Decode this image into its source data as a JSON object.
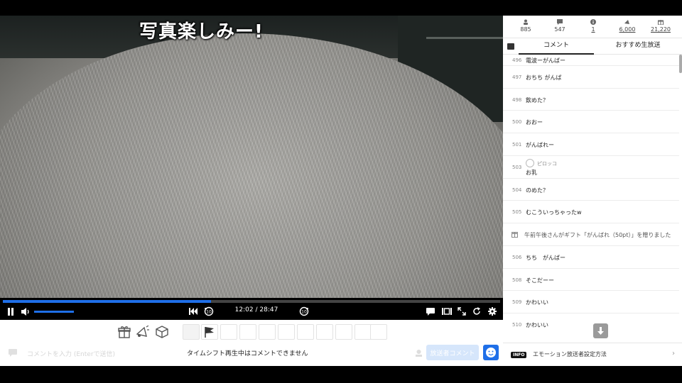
{
  "video": {
    "overlay_text": "写真楽しみー!"
  },
  "player": {
    "time_display": "12:02 / 28:47",
    "progress_fraction": 0.418,
    "volume_fraction": 0.9,
    "icons": {
      "pause": "pause-icon",
      "volume": "volume-icon",
      "skip_back": "skip-to-start-icon",
      "rewind": "rewind-10-icon",
      "forward": "forward-10-icon",
      "comment_toggle": "comment-icon",
      "theater": "theater-mode-icon",
      "fullscreen": "fullscreen-icon",
      "reload": "reload-icon",
      "settings": "gear-icon"
    }
  },
  "giftbar": {
    "icons": [
      "gift-icon",
      "advertise-icon",
      "box-icon",
      "flag-icon"
    ]
  },
  "input": {
    "placeholder": "コメントを入力 (Enterで送信)",
    "notice": "タイムシフト再生中はコメントできません",
    "post_label": "放送者コメント"
  },
  "stats": [
    {
      "icon": "viewer-icon",
      "value": "885"
    },
    {
      "icon": "comment-count-icon",
      "value": "547"
    },
    {
      "icon": "info-icon",
      "value": "1"
    },
    {
      "icon": "advertise-points-icon",
      "value": "6,000"
    },
    {
      "icon": "gift-points-icon",
      "value": "21,220"
    }
  ],
  "tabs": {
    "comments": "コメント",
    "recommended": "おすすめ生放送"
  },
  "comments": [
    {
      "no": "496",
      "text": "電波ーがんばー"
    },
    {
      "no": "497",
      "text": "おちち がんば"
    },
    {
      "no": "498",
      "text": "飲めた？"
    },
    {
      "no": "500",
      "text": "おおー"
    },
    {
      "no": "501",
      "text": "がんばれー"
    },
    {
      "no": "503",
      "name": "ピロッコ",
      "text": "お乳"
    },
    {
      "no": "504",
      "text": "のめた？"
    },
    {
      "no": "505",
      "text": "むこういっちゃったw"
    },
    {
      "no": "",
      "text": "午前午後さんがギフト「がんばれ（50pt）」を贈りました",
      "system": true
    },
    {
      "no": "506",
      "text": "ちち　がんばー"
    },
    {
      "no": "508",
      "text": "そこだーー"
    },
    {
      "no": "509",
      "text": "かわいい"
    },
    {
      "no": "510",
      "text": "かわいい"
    }
  ],
  "info": {
    "badge": "INFO",
    "text": "エモーション放送者設定方法"
  }
}
